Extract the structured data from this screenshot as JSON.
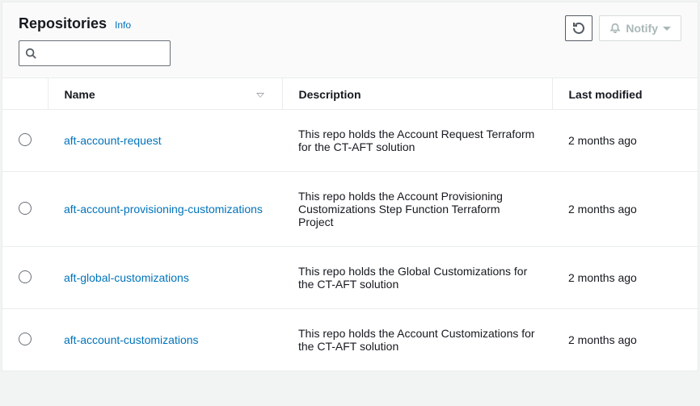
{
  "header": {
    "title": "Repositories",
    "info_label": "Info",
    "notify_label": "Notify",
    "search_placeholder": ""
  },
  "columns": {
    "name": "Name",
    "description": "Description",
    "last_modified": "Last modified"
  },
  "rows": [
    {
      "name": "aft-account-request",
      "description": "This repo holds the Account Request Terraform for the CT-AFT solution",
      "last_modified": "2 months ago"
    },
    {
      "name": "aft-account-provisioning-customizations",
      "description": "This repo holds the Account Provisioning Customizations Step Function Terraform Project",
      "last_modified": "2 months ago"
    },
    {
      "name": "aft-global-customizations",
      "description": "This repo holds the Global Customizations for the CT-AFT solution",
      "last_modified": "2 months ago"
    },
    {
      "name": "aft-account-customizations",
      "description": "This repo holds the Account Customizations for the CT-AFT solution",
      "last_modified": "2 months ago"
    }
  ]
}
